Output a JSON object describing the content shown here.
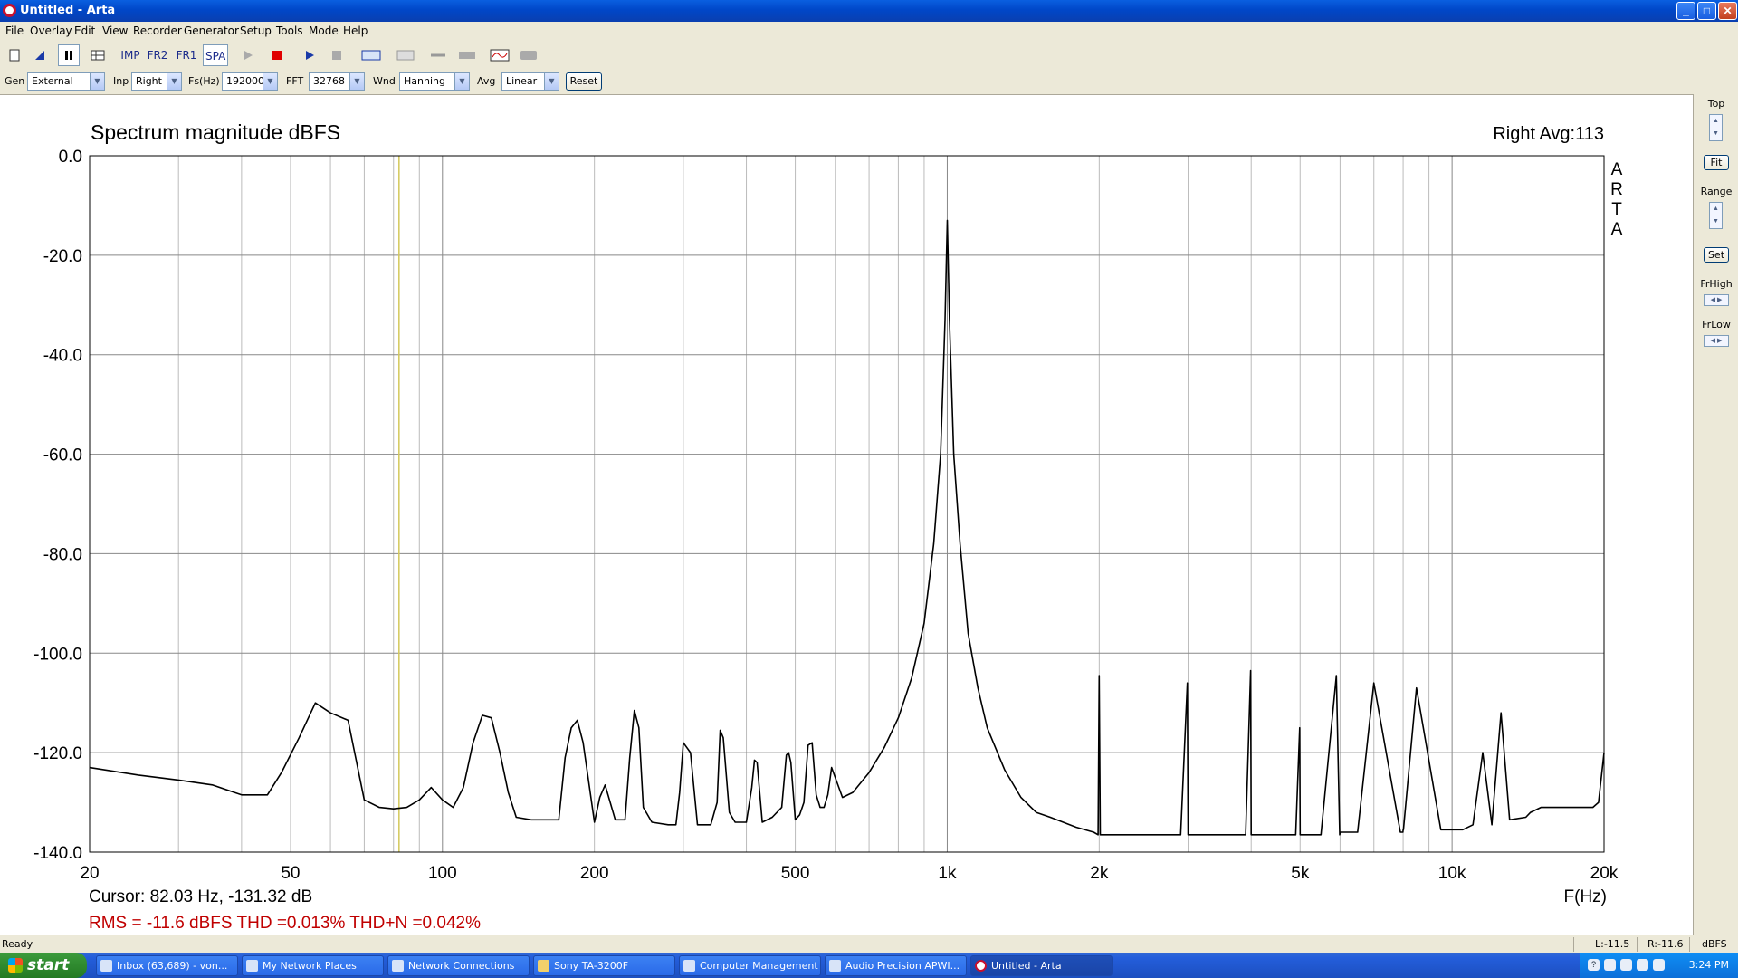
{
  "window": {
    "title": "Untitled - Arta",
    "min": "_",
    "max": "□",
    "close": "✕"
  },
  "menu": [
    "File",
    "Overlay",
    "Edit",
    "View",
    "Recorder",
    "Generator",
    "Setup",
    "Tools",
    "Mode",
    "Help"
  ],
  "toolbar": {
    "imp": "IMP",
    "fr2": "FR2",
    "fr1": "FR1",
    "spa": "SPA",
    "icons": [
      "new-icon",
      "open-icon",
      "pause-icon",
      "table-icon",
      "play-icon",
      "record-stop-icon",
      "run-icon",
      "stop-icon",
      "abc-icon",
      "hatch-icon",
      "link-icon",
      "bar-icon",
      "scope-icon",
      "rect-icon"
    ]
  },
  "settings": {
    "gen_label": "Gen",
    "gen_value": "External",
    "inp_label": "Inp",
    "inp_value": "Right",
    "fs_label": "Fs(Hz)",
    "fs_value": "192000",
    "fft_label": "FFT",
    "fft_value": "32768",
    "wnd_label": "Wnd",
    "wnd_value": "Hanning",
    "avg_label": "Avg",
    "avg_value": "Linear",
    "reset": "Reset"
  },
  "plot": {
    "cursor_text": "Cursor: 82.03 Hz, -131.32 dB",
    "stats_text": "RMS =  -11.6 dBFS  THD =0.013%  THD+N =0.042%",
    "channel_avg": "Right  Avg:113",
    "watermark": [
      "A",
      "R",
      "T",
      "A"
    ],
    "cursor_freq": 82.03,
    "cursor_color": "#d4c85a",
    "stats_color": "#c00000"
  },
  "chart_data": {
    "type": "line",
    "title": "Spectrum magnitude dBFS",
    "xlabel": "F(Hz)",
    "ylabel": "",
    "xscale": "log",
    "xlim": [
      20,
      20000
    ],
    "ylim": [
      -140,
      0
    ],
    "grid": true,
    "xticks": [
      20,
      50,
      100,
      200,
      500,
      1000,
      2000,
      5000,
      10000,
      20000
    ],
    "xtick_labels": [
      "20",
      "50",
      "100",
      "200",
      "500",
      "1k",
      "2k",
      "5k",
      "10k",
      "20k"
    ],
    "yticks": [
      0,
      -20,
      -40,
      -60,
      -80,
      -100,
      -120,
      -140
    ],
    "ytick_labels": [
      "0.0",
      "-20.0",
      "-40.0",
      "-60.0",
      "-80.0",
      "-100.0",
      "-120.0",
      "-140.0"
    ],
    "series": [
      {
        "color": "#000000",
        "x": [
          20,
          25,
          30,
          35,
          40,
          45,
          48,
          52,
          56,
          60,
          65,
          70,
          75,
          80,
          85,
          90,
          95,
          100,
          105,
          110,
          115,
          120,
          125,
          130,
          135,
          140,
          150,
          160,
          170,
          175,
          180,
          185,
          190,
          200,
          205,
          210,
          220,
          230,
          235,
          240,
          245,
          250,
          260,
          280,
          290,
          295,
          300,
          310,
          320,
          340,
          350,
          355,
          360,
          370,
          380,
          400,
          410,
          415,
          420,
          430,
          450,
          470,
          480,
          485,
          490,
          500,
          510,
          520,
          530,
          540,
          550,
          560,
          570,
          580,
          590,
          600,
          620,
          650,
          700,
          750,
          800,
          850,
          900,
          940,
          970,
          990,
          1000,
          1010,
          1030,
          1060,
          1100,
          1150,
          1200,
          1300,
          1400,
          1500,
          1600,
          1800,
          1950,
          1990,
          2000,
          2010,
          2050,
          2200,
          2500,
          2900,
          2990,
          3000,
          3010,
          3200,
          3500,
          3900,
          3990,
          4000,
          4010,
          4300,
          4900,
          4990,
          5000,
          5010,
          5500,
          5900,
          5990,
          6000,
          6010,
          6500,
          7000,
          7900,
          7990,
          8000,
          8010,
          8500,
          9500,
          9990,
          10000,
          10010,
          10500,
          11000,
          11500,
          11990,
          12000,
          12010,
          12500,
          13000,
          14000,
          14300,
          15000,
          16000,
          17000,
          18000,
          19000,
          19500,
          20000
        ],
        "y": [
          -123,
          -124.5,
          -125.5,
          -126.5,
          -128.5,
          -128.5,
          -124,
          -117,
          -110,
          -112,
          -113.5,
          -129.5,
          -131,
          -131.3,
          -131,
          -129.5,
          -127,
          -129.5,
          -131,
          -127,
          -118,
          -112.5,
          -113,
          -120,
          -128,
          -133,
          -133.5,
          -133.5,
          -133.5,
          -121,
          -115,
          -113.5,
          -118,
          -134,
          -129,
          -126.5,
          -133.5,
          -133.5,
          -121,
          -111.5,
          -115,
          -131,
          -134,
          -134.5,
          -134.5,
          -128,
          -118,
          -120,
          -134.5,
          -134.5,
          -130,
          -115.5,
          -117,
          -132,
          -134,
          -134,
          -127,
          -121.5,
          -122,
          -134,
          -133,
          -131,
          -120.5,
          -120,
          -122,
          -133.5,
          -132.5,
          -130,
          -118.5,
          -118,
          -128.5,
          -131,
          -131,
          -128.5,
          -123,
          -125,
          -129,
          -128,
          -124,
          -119,
          -113,
          -105,
          -94,
          -78,
          -60,
          -33,
          -13,
          -33,
          -60,
          -78,
          -96,
          -107,
          -115,
          -123.5,
          -129,
          -132,
          -133,
          -135,
          -136,
          -136.5,
          -104.5,
          -136.5,
          -136.5,
          -136.5,
          -136.5,
          -136.5,
          -106,
          -136.5,
          -136.5,
          -136.5,
          -136.5,
          -136.5,
          -103.5,
          -136.5,
          -136.5,
          -136.5,
          -136.5,
          -115,
          -136.5,
          -136.5,
          -136.5,
          -104.5,
          -136.5,
          -136,
          -136,
          -136,
          -106,
          -136,
          -136,
          -135.5,
          -135.5,
          -107,
          -135.5,
          -135.5,
          -135.5,
          -135.5,
          -135.5,
          -134.5,
          -120,
          -134.5,
          -134,
          -133.5,
          -112,
          -133.5,
          -133,
          -132,
          -131,
          -131,
          -131,
          -131,
          -131,
          -130,
          -120
        ]
      }
    ]
  },
  "right_panel": {
    "top": "Top",
    "fit": "Fit",
    "range": "Range",
    "set": "Set",
    "frhigh": "FrHigh",
    "frlow": "FrLow",
    "up": "▲",
    "down": "▼",
    "left": "◀",
    "right": "▶"
  },
  "status": {
    "ready": "Ready",
    "left": "L:-11.5",
    "right": "R:-11.6",
    "unit": "dBFS"
  },
  "taskbar": {
    "start": "start",
    "tasks": [
      "Inbox (63,689) - von...",
      "My Network Places",
      "Network Connections",
      "Sony TA-3200F",
      "Computer Management",
      "Audio Precision APWI...",
      "Untitled - Arta"
    ],
    "clock": "3:24 PM",
    "help_glyph": "?"
  }
}
